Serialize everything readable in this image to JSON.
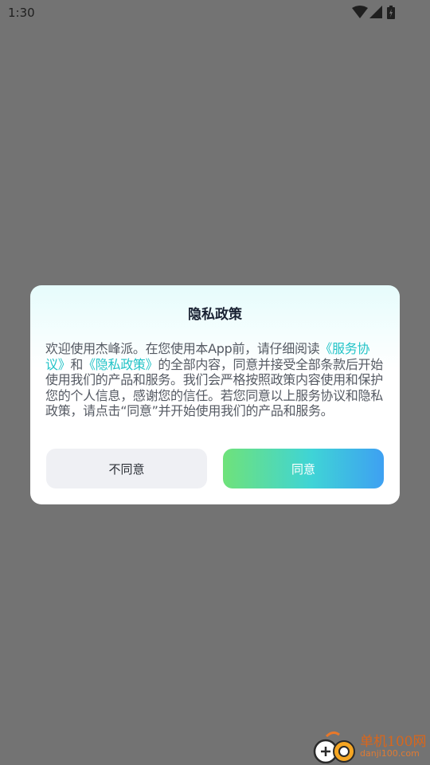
{
  "status_bar": {
    "time": "1:30",
    "icons": [
      "wifi-icon",
      "signal-icon",
      "battery-icon"
    ]
  },
  "dialog": {
    "title": "隐私政策",
    "body": {
      "intro": "欢迎使用杰峰派。在您使用本App前，请仔细阅读",
      "link_service": "《服务协议》",
      "and": "和",
      "link_privacy": "《隐私政策》",
      "rest": "的全部内容，同意并接受全部条款后开始使用我们的产品和服务。我们会严格按照政策内容使用和保护您的个人信息，感谢您的信任。若您同意以上服务协议和隐私政策，请点击“同意”并开始使用我们的产品和服务。"
    },
    "disagree_label": "不同意",
    "agree_label": "同意"
  },
  "watermark": {
    "name": "单机100网",
    "url": "danji100.com"
  },
  "colors": {
    "overlay": "#737373",
    "link": "#22c3c7",
    "agree_gradient": [
      "#6fe27a",
      "#3fd4d6",
      "#3ea0f2"
    ],
    "disagree_bg": "#eff0f4"
  }
}
